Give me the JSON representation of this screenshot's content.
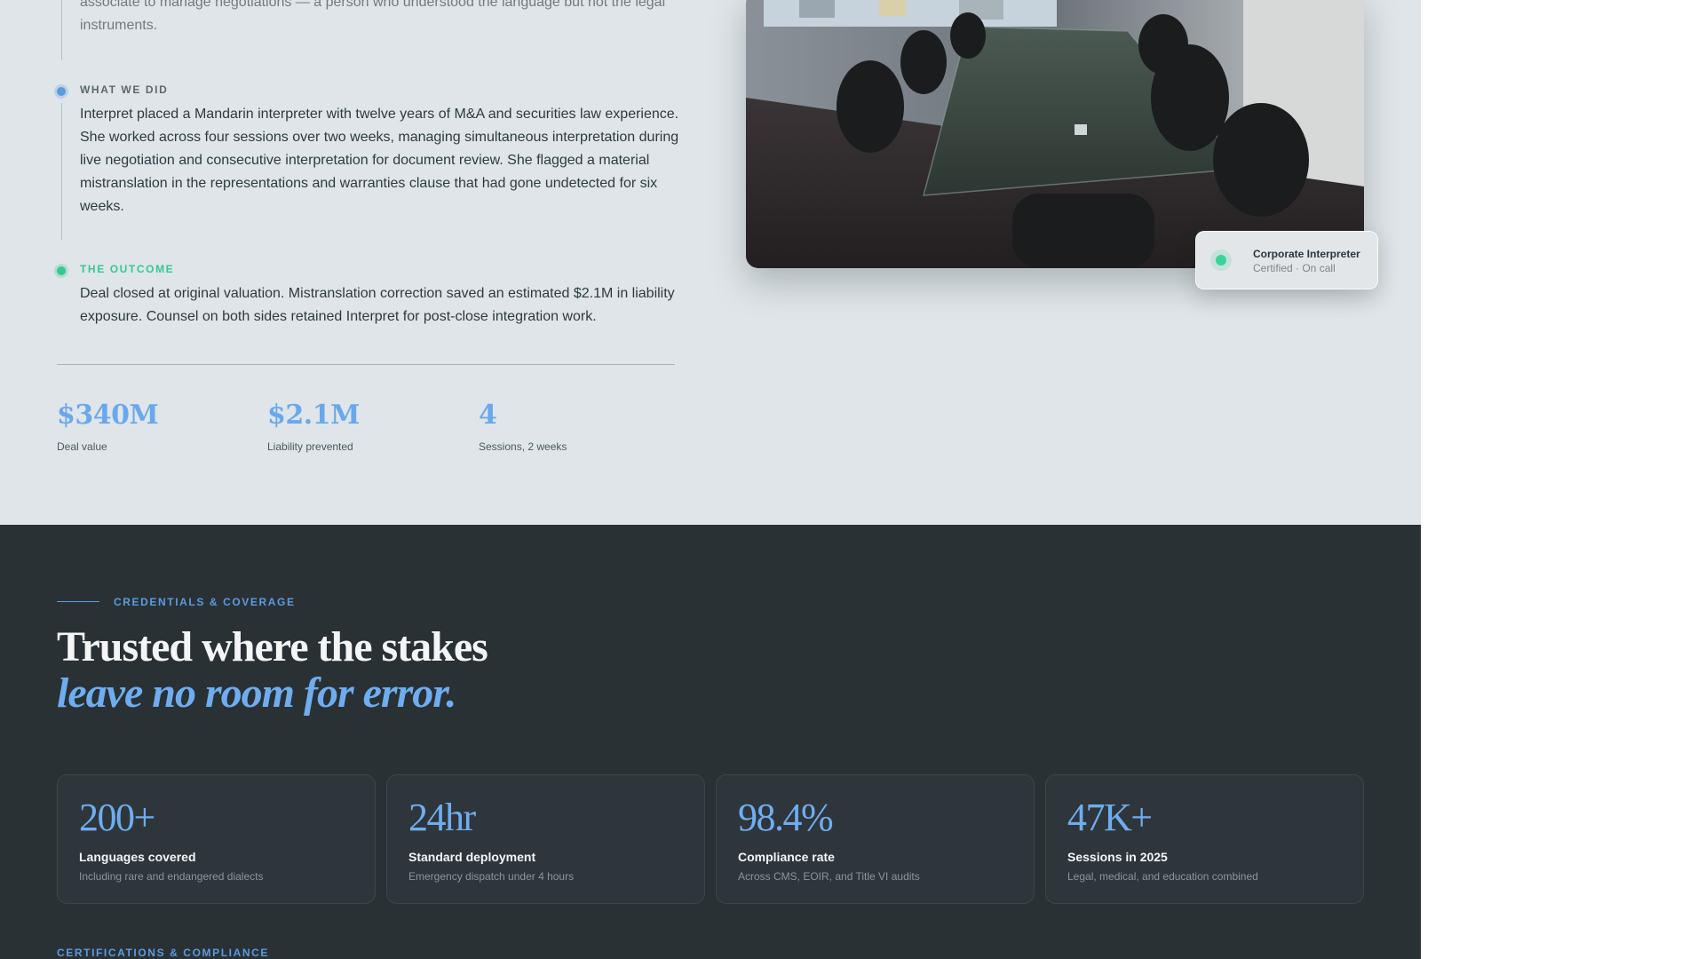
{
  "case_study": {
    "intro_text_tail": "associate to manage negotiations — a person who understood the language but not the legal instruments.",
    "what_we_did": {
      "label": "WHAT WE DID",
      "text": "Interpret placed a Mandarin interpreter with twelve years of M&A and securities law experience. She worked across four sessions over two weeks, managing simultaneous interpretation during live negotiation and consecutive interpretation for document review. She flagged a material mistranslation in the representations and warranties clause that had gone undetected for six weeks."
    },
    "outcome": {
      "label": "THE OUTCOME",
      "text": "Deal closed at original valuation. Mistranslation correction saved an estimated $2.1M in liability exposure. Counsel on both sides retained Interpret for post-close integration work."
    },
    "stats": [
      {
        "value": "$340M",
        "caption": "Deal value"
      },
      {
        "value": "$2.1M",
        "caption": "Liability prevented"
      },
      {
        "value": "4",
        "caption": "Sessions, 2 weeks"
      }
    ],
    "photo_badge": {
      "title": "Corporate Interpreter",
      "subtitle": "Certified · On call"
    }
  },
  "credentials": {
    "eyebrow": "CREDENTIALS & COVERAGE",
    "headline_line1": "Trusted where the stakes",
    "headline_line2": "leave no room for error.",
    "cards": [
      {
        "value": "200+",
        "title": "Languages covered",
        "subtitle": "Including rare and endangered dialects"
      },
      {
        "value": "24hr",
        "title": "Standard deployment",
        "subtitle": "Emergency dispatch under 4 hours"
      },
      {
        "value": "98.4%",
        "title": "Compliance rate",
        "subtitle": "Across CMS, EOIR, and Title VI audits"
      },
      {
        "value": "47K+",
        "title": "Sessions in 2025",
        "subtitle": "Legal, medical, and education combined"
      }
    ],
    "certifications_label": "CERTIFICATIONS & COMPLIANCE"
  },
  "colors": {
    "accent_blue": "#6fadf0",
    "accent_green": "#35c98f",
    "dark_bg": "#293135",
    "light_bg": "#dfe5e8"
  }
}
